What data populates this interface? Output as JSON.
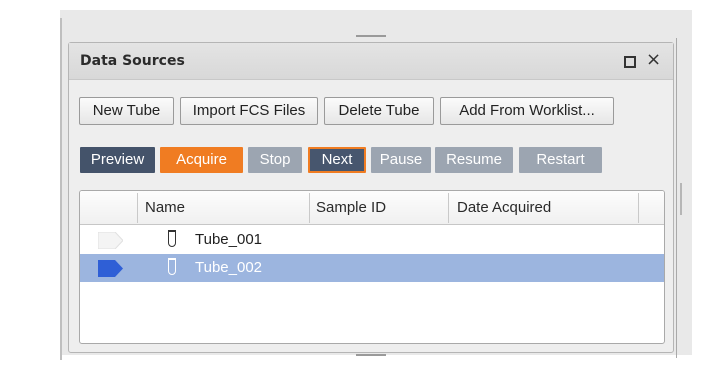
{
  "panel": {
    "title": "Data Sources",
    "maximize_icon": "maximize-icon",
    "close_icon": "close-icon",
    "close_glyph": "×"
  },
  "toolbar1": {
    "new_tube": "New Tube",
    "import_fcs": "Import FCS Files",
    "delete_tube": "Delete Tube",
    "add_from_worklist": "Add From Worklist..."
  },
  "toolbar2": {
    "preview": "Preview",
    "acquire": "Acquire",
    "stop": "Stop",
    "next": "Next",
    "pause": "Pause",
    "resume": "Resume",
    "restart": "Restart"
  },
  "grid": {
    "columns": [
      "Name",
      "Sample ID",
      "Date Acquired"
    ],
    "rows": [
      {
        "name": "Tube_001",
        "sample_id": "",
        "date_acquired": "",
        "selected": false,
        "indicator_icon": "inactive-pointer-icon"
      },
      {
        "name": "Tube_002",
        "sample_id": "",
        "date_acquired": "",
        "selected": true,
        "indicator_icon": "current-pointer-icon"
      }
    ]
  },
  "colors": {
    "preview_bg": "#44536a",
    "acquire_bg": "#f07c22",
    "disabled_bg": "#9ca5b1",
    "next_border": "#f07c22",
    "selected_row": "#9cb5df",
    "current_pointer": "#2f5fd6"
  }
}
